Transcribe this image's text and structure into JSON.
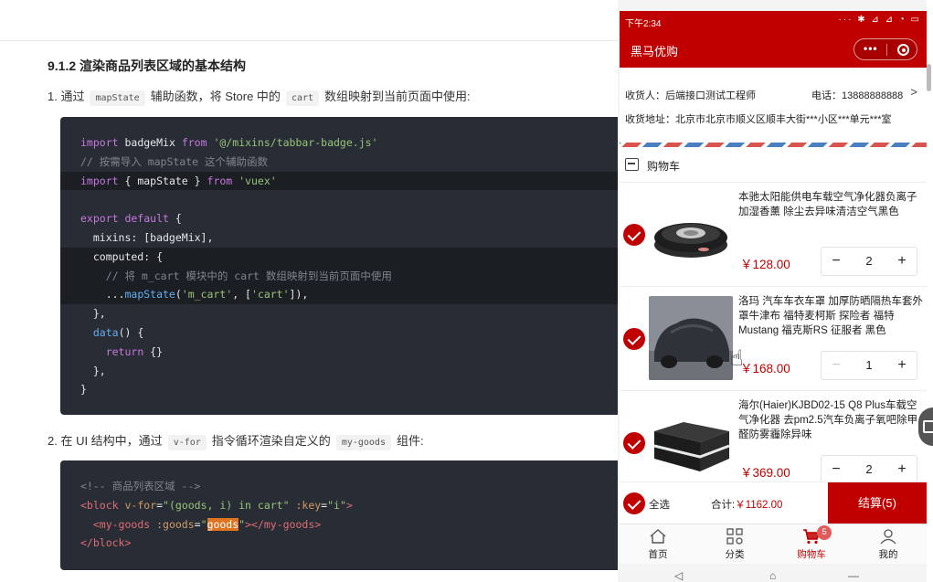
{
  "doc": {
    "heading": "9.1.2 渲染商品列表区域的基本结构",
    "step1": {
      "prefix": "1. 通过",
      "code1": "mapState",
      "mid1": "辅助函数，将 Store 中的",
      "code2": "cart",
      "suffix": "数组映射到当前页面中使用:"
    },
    "code_block_1": [
      "import badgeMix from '@/mixins/tabbar-badge.js'",
      "// 按需导入 mapState 这个辅助函数",
      "import { mapState } from 'vuex'",
      "",
      "export default {",
      "  mixins: [badgeMix],",
      "  computed: {",
      "    // 将 m_cart 模块中的 cart 数组映射到当前页面中使用",
      "    ...mapState('m_cart', ['cart']),",
      "  },",
      "  data() {",
      "    return {}",
      "  },",
      "}"
    ],
    "step2": {
      "prefix": "2. 在 UI 结构中，通过",
      "code1": "v-for",
      "mid1": "指令循环渲染自定义的",
      "code2": "my-goods",
      "suffix": "组件:"
    },
    "code_block_2": [
      "<!-- 商品列表区域 -->",
      "<block v-for=\"(goods, i) in cart\" :key=\"i\">",
      "  <my-goods :goods=\"goods\"></my-goods>",
      "</block>"
    ]
  },
  "phone": {
    "status": {
      "time": "下午2:34",
      "icons": "··· ✱ ⊿ ⊿ ◔ ▭"
    },
    "nav": {
      "title": "黑马优购"
    },
    "address": {
      "receiver": "收货人：后端接口测试工程师",
      "phone": "电话：13888888888",
      "arrow": ">",
      "addr": "收货地址：北京市北京市顺义区顺丰大街***小区***单元***室"
    },
    "cart_title": "购物车",
    "items": [
      {
        "name": "本驰太阳能供电车载空气净化器负离子加湿香薰 除尘去异味清洁空气黑色",
        "price": "￥128.00",
        "qty": "2"
      },
      {
        "name": "洛玛 汽车车衣车罩 加厚防晒隔热车套外罩牛津布 福特麦柯斯 探险者 福特Mustang 福克斯RS 征服者 黑色",
        "price": "￥168.00",
        "qty": "1"
      },
      {
        "name": "海尔(Haier)KJBD02-15 Q8 Plus车载空气净化器 去pm2.5汽车负离子氧吧除甲醛防雾霾除异味",
        "price": "￥369.00",
        "qty": "2"
      }
    ],
    "settle": {
      "all": "全选",
      "total_label": "合计:",
      "total_value": "￥1162.00",
      "button": "结算(5)"
    },
    "tabs": [
      {
        "label": "首页"
      },
      {
        "label": "分类"
      },
      {
        "label": "购物车",
        "badge": "5"
      },
      {
        "label": "我的"
      }
    ],
    "sysnav": {
      "menu": "—",
      "home": "⌂",
      "back": "◁"
    },
    "minus": "−",
    "plus": "+"
  },
  "colors": {
    "brand": "#c00000",
    "code_bg": "#282c34"
  }
}
